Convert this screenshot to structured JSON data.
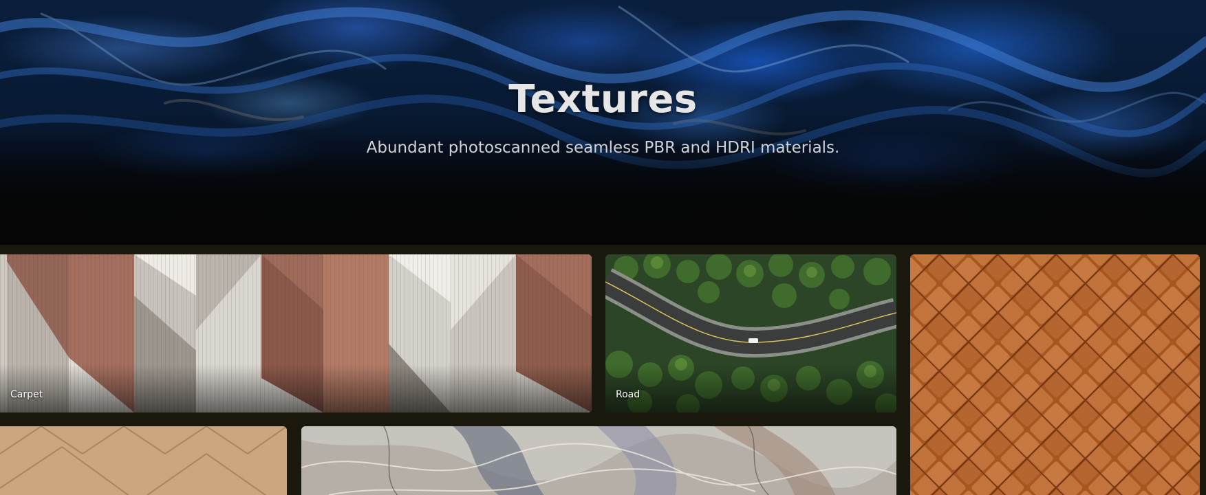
{
  "hero": {
    "title": "Textures",
    "subtitle": "Abundant photoscanned seamless PBR and HDRI materials."
  },
  "tiles": [
    {
      "label": "Carpet"
    },
    {
      "label": "Road"
    },
    {
      "label": ""
    },
    {
      "label": ""
    },
    {
      "label": ""
    }
  ],
  "colors": {
    "background": "#050505",
    "hero_blue": "#0a1f3d",
    "grid_background": "#1a180c",
    "title": "#e6e6e6",
    "subtitle": "#cfd3d8"
  }
}
